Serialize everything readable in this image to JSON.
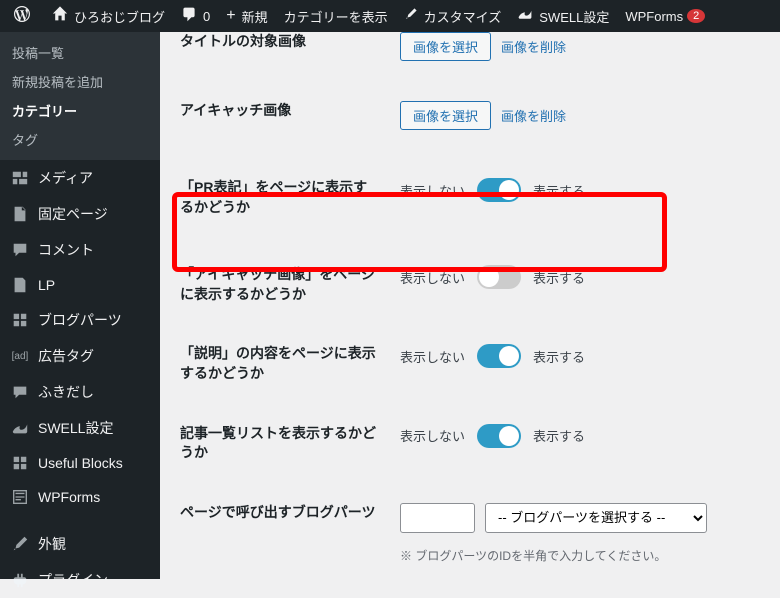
{
  "adminbar": {
    "site_title": "ひろおじブログ",
    "comments_count": "0",
    "new_label": "新規",
    "view_cat_label": "カテゴリーを表示",
    "customize_label": "カスタマイズ",
    "swell_label": "SWELL設定",
    "wpforms_label": "WPForms",
    "wpforms_badge": "2"
  },
  "sidebar": {
    "submenu": {
      "all_posts": "投稿一覧",
      "new_post": "新規投稿を追加",
      "categories": "カテゴリー",
      "tags": "タグ"
    },
    "items": [
      {
        "icon": "media",
        "label": "メディア"
      },
      {
        "icon": "page",
        "label": "固定ページ"
      },
      {
        "icon": "comment",
        "label": "コメント"
      },
      {
        "icon": "page2",
        "label": "LP"
      },
      {
        "icon": "grid",
        "label": "ブログパーツ"
      },
      {
        "icon": "ad",
        "label": "広告タグ"
      },
      {
        "icon": "balloon",
        "label": "ふきだし"
      },
      {
        "icon": "swell",
        "label": "SWELL設定"
      },
      {
        "icon": "blocks",
        "label": "Useful Blocks"
      },
      {
        "icon": "wpf",
        "label": "WPForms"
      },
      {
        "icon": "brush",
        "label": "外観"
      },
      {
        "icon": "plugin",
        "label": "プラグイン"
      }
    ]
  },
  "form": {
    "title_row_label": "タイトルの対象画像",
    "select_image_btn": "画像を選択",
    "delete_image_link": "画像を削除",
    "eyecatch_label": "アイキャッチ画像",
    "pr_display_label": "「PR表記」をページに表示するかどうか",
    "eyecatch_display_label": "「アイキャッチ画像」をページに表示するかどうか",
    "desc_display_label": "「説明」の内容をページに表示するかどうか",
    "list_display_label": "記事一覧リストを表示するかどうか",
    "toggle_off_label": "表示しない",
    "toggle_on_label": "表示する",
    "blogparts_label": "ページで呼び出すブログパーツ",
    "blogparts_select_placeholder": "-- ブログパーツを選択する --",
    "blogparts_desc": "※ ブログパーツのIDを半角で入力してください。"
  }
}
